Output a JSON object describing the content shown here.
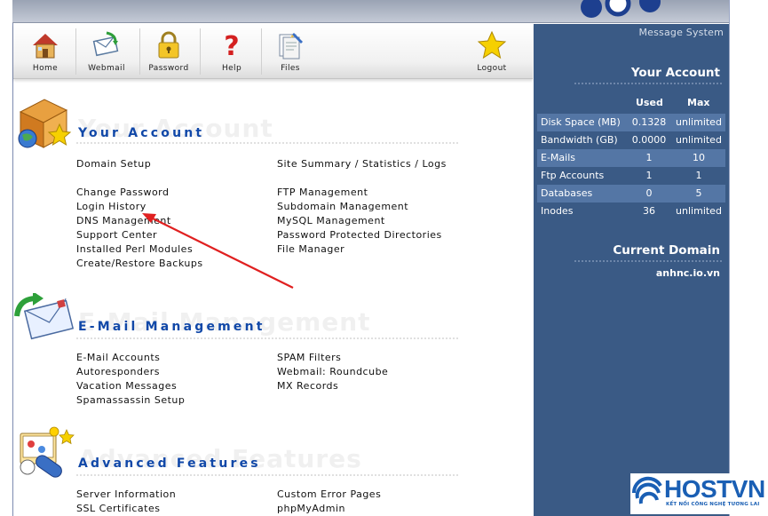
{
  "toolbar": {
    "home": "Home",
    "webmail": "Webmail",
    "password": "Password",
    "help": "Help",
    "files": "Files",
    "logout": "Logout"
  },
  "panel": {
    "message_system": "Message System",
    "your_account_heading": "Your Account",
    "col_used": "Used",
    "col_max": "Max",
    "stats": [
      {
        "name": "Disk Space (MB)",
        "used": "0.1328",
        "max": "unlimited"
      },
      {
        "name": "Bandwidth (GB)",
        "used": "0.0000",
        "max": "unlimited"
      },
      {
        "name": "E-Mails",
        "used": "1",
        "max": "10"
      },
      {
        "name": "Ftp Accounts",
        "used": "1",
        "max": "1"
      },
      {
        "name": "Databases",
        "used": "0",
        "max": "5"
      },
      {
        "name": "Inodes",
        "used": "36",
        "max": "unlimited"
      }
    ],
    "current_domain_heading": "Current Domain",
    "current_domain": "anhnc.io.vn"
  },
  "sections": {
    "account": {
      "title": "Your Account",
      "ghost": "Your Account",
      "left": [
        "Domain Setup",
        "Change Password",
        "Login History",
        "DNS Management",
        "Support Center",
        "Installed Perl Modules",
        "Create/Restore Backups"
      ],
      "right": [
        "Site Summary / Statistics / Logs",
        "FTP Management",
        "Subdomain Management",
        "MySQL Management",
        "Password Protected Directories",
        "File Manager"
      ]
    },
    "email": {
      "title": "E-Mail Management",
      "ghost": "E-Mail Management",
      "left": [
        "E-Mail Accounts",
        "Autoresponders",
        "Vacation Messages",
        "Spamassassin Setup"
      ],
      "right": [
        "SPAM Filters",
        "Webmail: Roundcube",
        "MX Records"
      ]
    },
    "advanced": {
      "title": "Advanced Features",
      "ghost": "Advanced Features",
      "left": [
        "Server Information",
        "SSL Certificates"
      ],
      "right": [
        "Custom Error Pages",
        "phpMyAdmin"
      ]
    }
  },
  "watermark": {
    "brand": "HOSTVN",
    "tagline": "KẾT NỐI CÔNG NGHỆ TƯƠNG LAI"
  },
  "colors": {
    "panel_bg": "#3a5a85",
    "panel_row_alt": "#5476a5",
    "section_title": "#1148a8",
    "annotation_arrow": "#e02020"
  }
}
